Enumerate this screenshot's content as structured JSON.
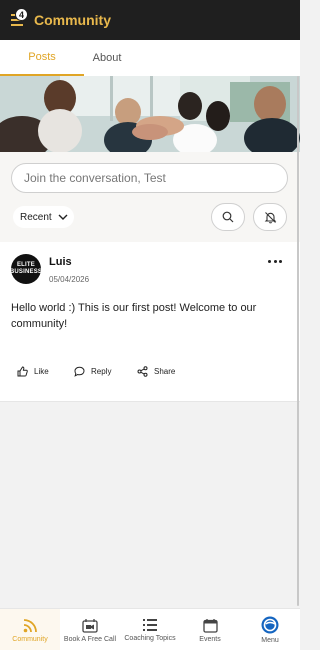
{
  "header": {
    "title": "Community",
    "notification_count": "4",
    "menu_icon": "hamburger-menu-icon"
  },
  "tabs": [
    {
      "label": "Posts",
      "active": true
    },
    {
      "label": "About",
      "active": false
    }
  ],
  "composer": {
    "placeholder": "Join the conversation, Test"
  },
  "filter": {
    "sort_label": "Recent"
  },
  "post": {
    "avatar_text_line1": "ELITE",
    "avatar_text_line2": "BUSINESS",
    "author": "Luis",
    "date": "05/04/2026",
    "body": "Hello world :) This is our first post! Welcome to our community!",
    "actions": {
      "like": "Like",
      "reply": "Reply",
      "share": "Share"
    }
  },
  "bottom_nav": [
    {
      "label": "Community",
      "icon": "rss-icon",
      "active": true
    },
    {
      "label": "Book A Free Call",
      "icon": "calendar-video-icon",
      "active": false
    },
    {
      "label": "Coaching Topics",
      "icon": "list-icon",
      "active": false
    },
    {
      "label": "Events",
      "icon": "calendar-icon",
      "active": false
    },
    {
      "label": "Menu",
      "icon": "brand-logo-icon",
      "active": false
    }
  ],
  "colors": {
    "accent": "#e0a526",
    "header_bg": "#1f1f1f",
    "title": "#e8b84c",
    "brand_blue": "#1565c0"
  }
}
